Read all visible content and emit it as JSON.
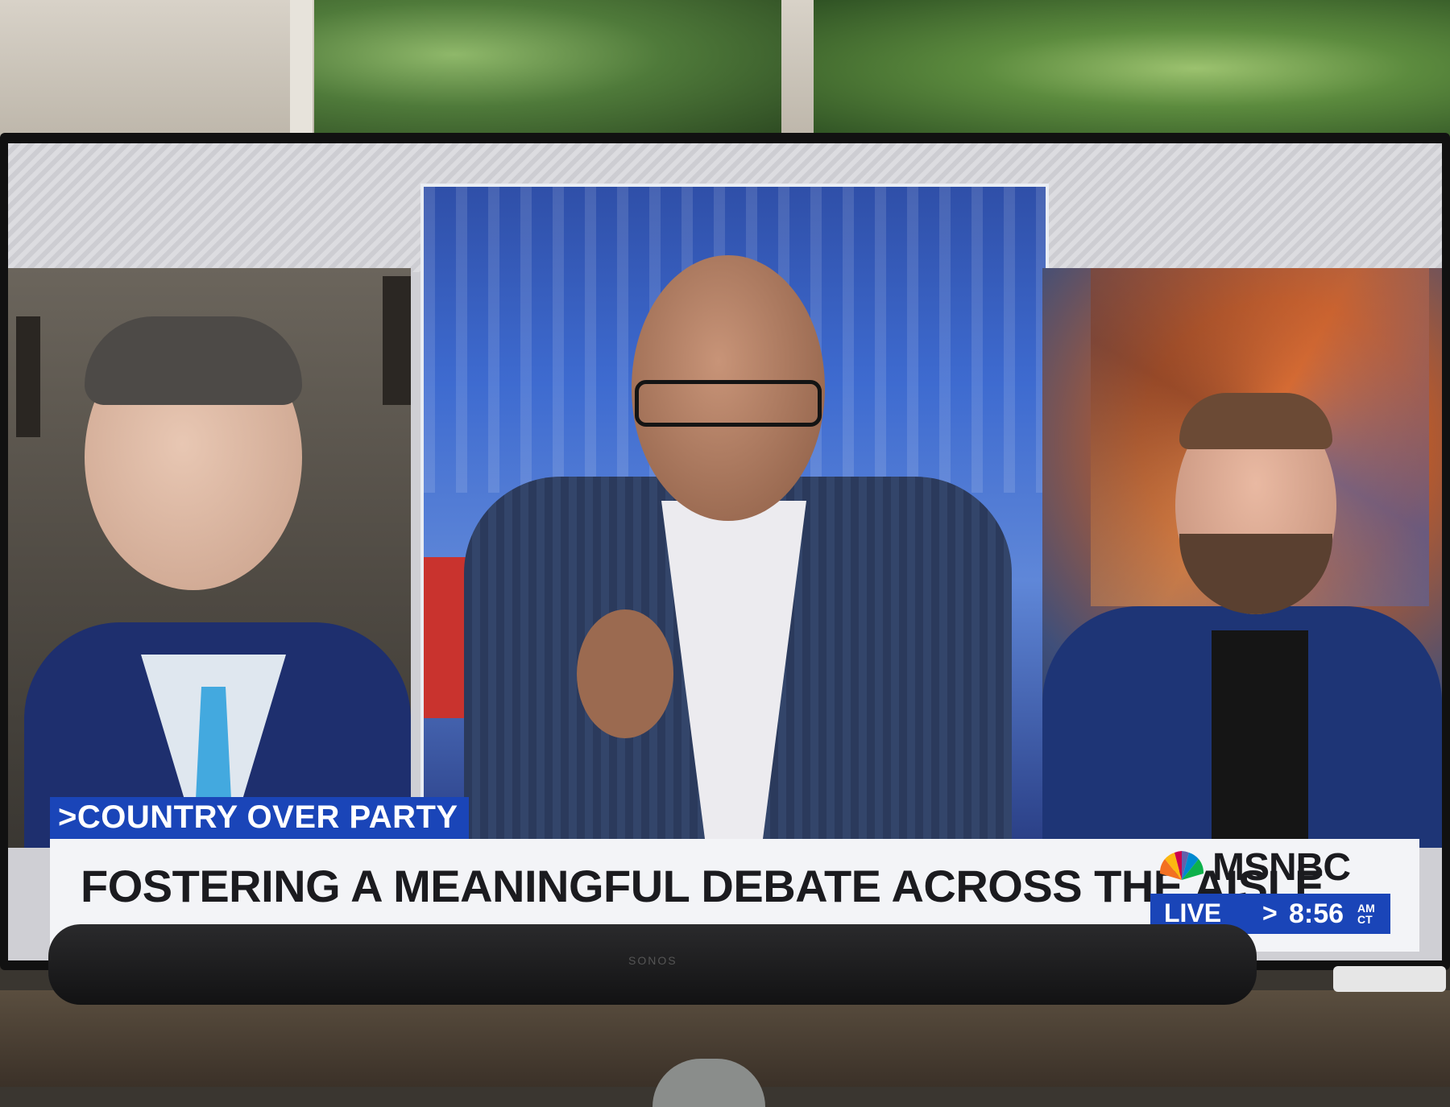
{
  "broadcast": {
    "segment_tag": ">COUNTRY OVER PARTY",
    "headline": "FOSTERING A MEANINGFUL DEBATE ACROSS THE AISLE",
    "network": "MSNBC",
    "live_label": "LIVE",
    "live_arrow": ">",
    "time": "8:56",
    "time_ampm": "AM",
    "time_zone": "CT"
  },
  "soundbar": {
    "brand": "SONOS"
  },
  "colors": {
    "banner_blue": "#1a45b8",
    "banner_white": "#f3f4f7",
    "headline_text": "#1b1b1f"
  }
}
